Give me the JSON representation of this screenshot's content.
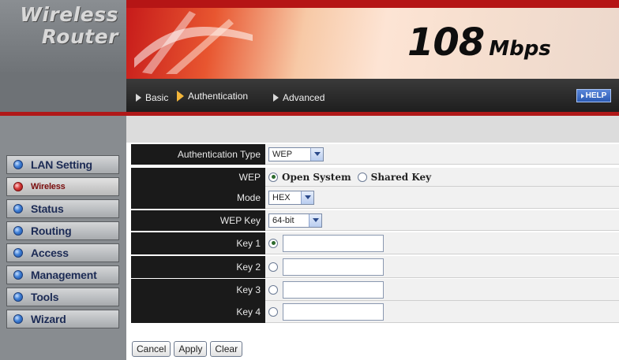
{
  "brand": {
    "line1": "Wireless",
    "line2": "Router",
    "speed_number": "108",
    "speed_unit": "Mbps"
  },
  "nav": {
    "items": [
      {
        "label": "LAN Setting",
        "active": false
      },
      {
        "label": "Wireless",
        "active": true
      },
      {
        "label": "Status",
        "active": false
      },
      {
        "label": "Routing",
        "active": false
      },
      {
        "label": "Access",
        "active": false
      },
      {
        "label": "Management",
        "active": false
      },
      {
        "label": "Tools",
        "active": false
      },
      {
        "label": "Wizard",
        "active": false
      }
    ]
  },
  "tabs": [
    {
      "label": "Basic",
      "active": false
    },
    {
      "label": "Authentication",
      "active": true
    },
    {
      "label": "Advanced",
      "active": false
    }
  ],
  "help_label": "HELP",
  "form": {
    "auth_type_label": "Authentication Type",
    "auth_type_value": "WEP",
    "wep_label": "WEP",
    "wep_options": [
      "Open System",
      "Shared Key"
    ],
    "wep_selected": "Open System",
    "mode_label": "Mode",
    "mode_value": "HEX",
    "wep_key_label": "WEP Key",
    "wep_key_value": "64-bit",
    "keys": [
      {
        "label": "Key 1",
        "selected": true,
        "value": ""
      },
      {
        "label": "Key 2",
        "selected": false,
        "value": ""
      },
      {
        "label": "Key 3",
        "selected": false,
        "value": ""
      },
      {
        "label": "Key 4",
        "selected": false,
        "value": ""
      }
    ]
  },
  "buttons": {
    "cancel": "Cancel",
    "apply": "Apply",
    "clear": "Clear"
  },
  "colors": {
    "accent_red": "#b01818",
    "nav_text": "#1c2b55",
    "active_nav_dot": "#d83a3a",
    "nav_dot": "#3f7fd6"
  }
}
